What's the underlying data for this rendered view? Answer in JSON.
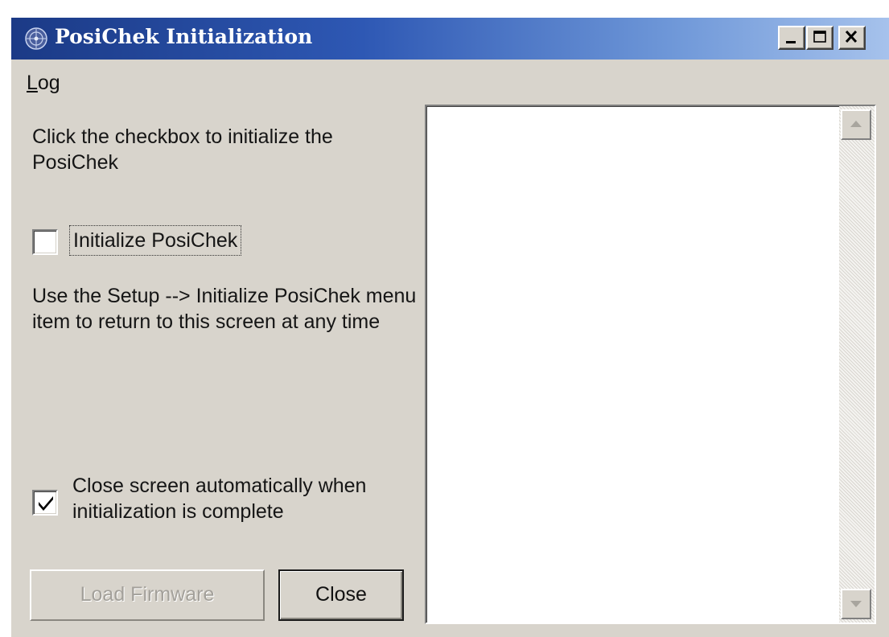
{
  "window": {
    "title": "PosiChek Initialization",
    "icon": "posichek-app-icon",
    "controls": [
      "minimize-icon",
      "maximize-icon",
      "close-icon"
    ]
  },
  "menu": {
    "items": [
      {
        "label_underlined": "L",
        "label_rest": "og"
      }
    ]
  },
  "instructions": {
    "intro": "Click the checkbox to initialize the PosiChek",
    "return_note": "Use the Setup --> Initialize PosiChek menu item to return to this screen at any time"
  },
  "initialize_checkbox": {
    "label": "Initialize PosiChek",
    "checked": false
  },
  "auto_close_checkbox": {
    "label": "Close screen automatically when initialization is complete",
    "checked": true
  },
  "buttons": {
    "load_firmware": "Load Firmware",
    "load_firmware_enabled": false,
    "close": "Close"
  },
  "log_panel": {
    "content": ""
  }
}
